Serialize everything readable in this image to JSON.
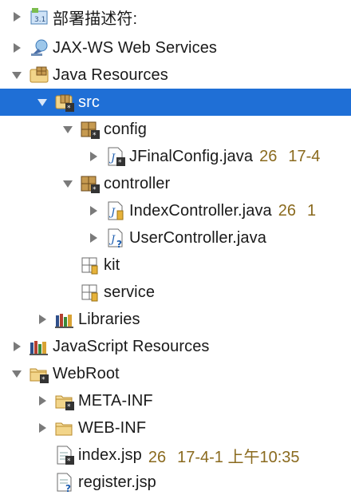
{
  "tree": {
    "rows": [
      {
        "label": "部署描述符:",
        "expanded": false,
        "icon": "deployment-descriptor-icon"
      },
      {
        "label": "JAX-WS Web Services",
        "expanded": false,
        "icon": "web-services-icon"
      },
      {
        "label": "Java Resources",
        "expanded": true,
        "icon": "java-resources-icon"
      },
      {
        "label": "src",
        "expanded": true,
        "selected": true,
        "icon": "source-folder-icon"
      },
      {
        "label": "config",
        "expanded": true,
        "icon": "package-icon"
      },
      {
        "label": "JFinalConfig.java",
        "meta_rev": "26",
        "meta_date": "17-4",
        "expanded": false,
        "icon": "java-file-icon"
      },
      {
        "label": "controller",
        "expanded": true,
        "icon": "package-icon"
      },
      {
        "label": "IndexController.java",
        "meta_rev": "26",
        "meta_date": "1",
        "expanded": false,
        "icon": "java-file-icon"
      },
      {
        "label": "UserController.java",
        "expanded": false,
        "icon": "java-file-unversioned-icon"
      },
      {
        "label": "kit",
        "icon": "empty-package-icon"
      },
      {
        "label": "service",
        "icon": "empty-package-icon"
      },
      {
        "label": "Libraries",
        "expanded": false,
        "icon": "libraries-icon"
      },
      {
        "label": "JavaScript Resources",
        "expanded": false,
        "icon": "libraries-icon"
      },
      {
        "label": "WebRoot",
        "expanded": true,
        "icon": "folder-versioned-icon"
      },
      {
        "label": "META-INF",
        "expanded": false,
        "icon": "folder-versioned-icon"
      },
      {
        "label": "WEB-INF",
        "expanded": false,
        "icon": "folder-icon"
      },
      {
        "label": "index.jsp",
        "meta_rev": "26",
        "meta_date": "17-4-1 上午10:35",
        "icon": "jsp-file-icon"
      },
      {
        "label": "register.jsp",
        "icon": "jsp-file-unversioned-icon"
      }
    ]
  },
  "colors": {
    "selection": "#1f6fd6",
    "meta_text": "#8a6a1e",
    "text": "#1a1a1a"
  }
}
